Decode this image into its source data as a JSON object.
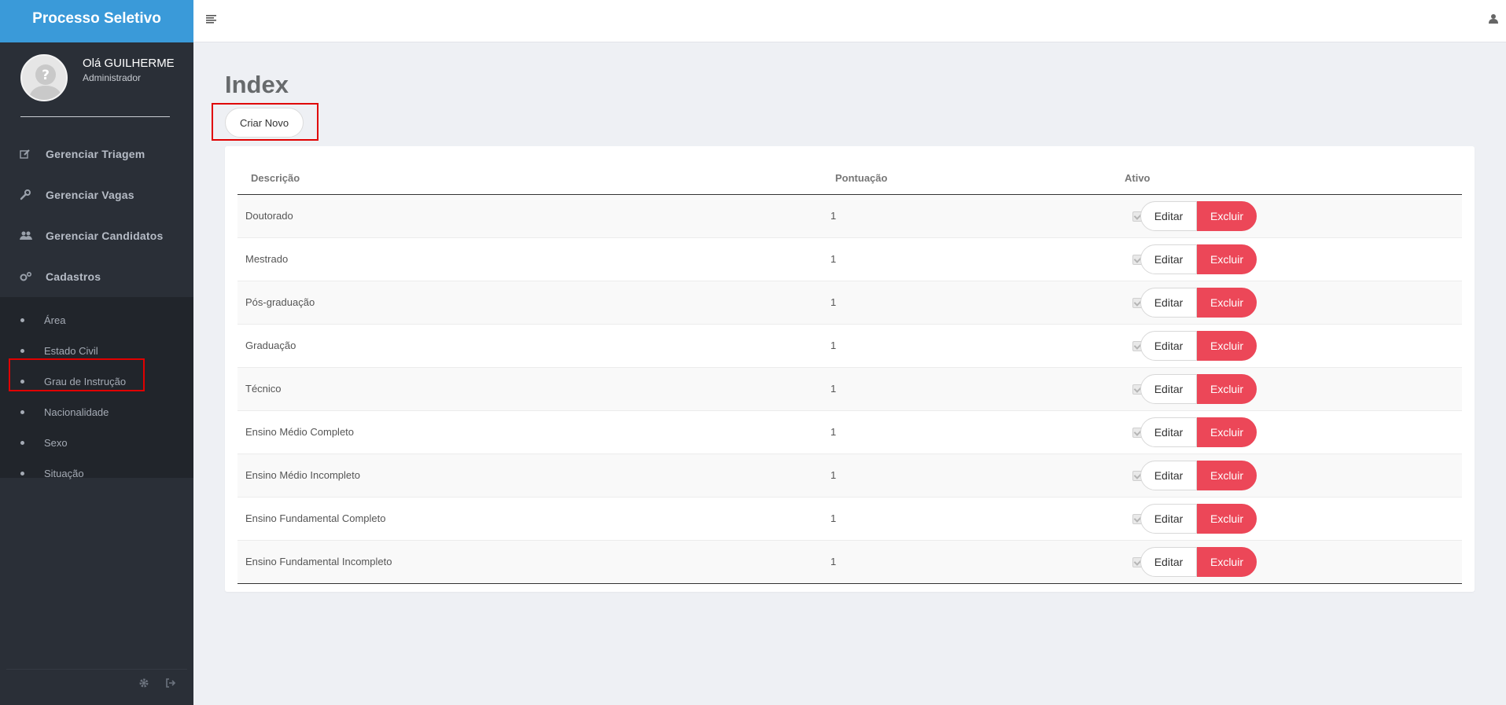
{
  "sidebar": {
    "brand": "Processo Seletivo",
    "greeting": "Olá GUILHERME",
    "role": "Administrador",
    "nav": [
      {
        "label": "Gerenciar Triagem",
        "icon": "edit-icon"
      },
      {
        "label": "Gerenciar Vagas",
        "icon": "wrench-icon"
      },
      {
        "label": "Gerenciar Candidatos",
        "icon": "users-icon"
      },
      {
        "label": "Cadastros",
        "icon": "gears-icon"
      }
    ],
    "submenu": [
      {
        "label": "Área"
      },
      {
        "label": "Estado Civil"
      },
      {
        "label": "Grau de Instrução"
      },
      {
        "label": "Nacionalidade"
      },
      {
        "label": "Sexo"
      },
      {
        "label": "Situação"
      }
    ]
  },
  "page": {
    "title": "Index",
    "create_label": "Criar Novo"
  },
  "table": {
    "headers": [
      "Descrição",
      "Pontuação",
      "Ativo"
    ],
    "rows": [
      {
        "descricao": "Doutorado",
        "pontuacao": "1",
        "ativo": true
      },
      {
        "descricao": "Mestrado",
        "pontuacao": "1",
        "ativo": true
      },
      {
        "descricao": "Pós-graduação",
        "pontuacao": "1",
        "ativo": true
      },
      {
        "descricao": "Graduação",
        "pontuacao": "1",
        "ativo": true
      },
      {
        "descricao": "Técnico",
        "pontuacao": "1",
        "ativo": true
      },
      {
        "descricao": "Ensino Médio Completo",
        "pontuacao": "1",
        "ativo": true
      },
      {
        "descricao": "Ensino Médio Incompleto",
        "pontuacao": "1",
        "ativo": true
      },
      {
        "descricao": "Ensino Fundamental Completo",
        "pontuacao": "1",
        "ativo": true
      },
      {
        "descricao": "Ensino Fundamental Incompleto",
        "pontuacao": "1",
        "ativo": true
      }
    ],
    "edit_label": "Editar",
    "delete_label": "Excluir"
  },
  "colors": {
    "brand": "#3a9ad9",
    "sidebar": "#2a2f37",
    "danger": "#ec4758",
    "highlight": "#e00000"
  }
}
